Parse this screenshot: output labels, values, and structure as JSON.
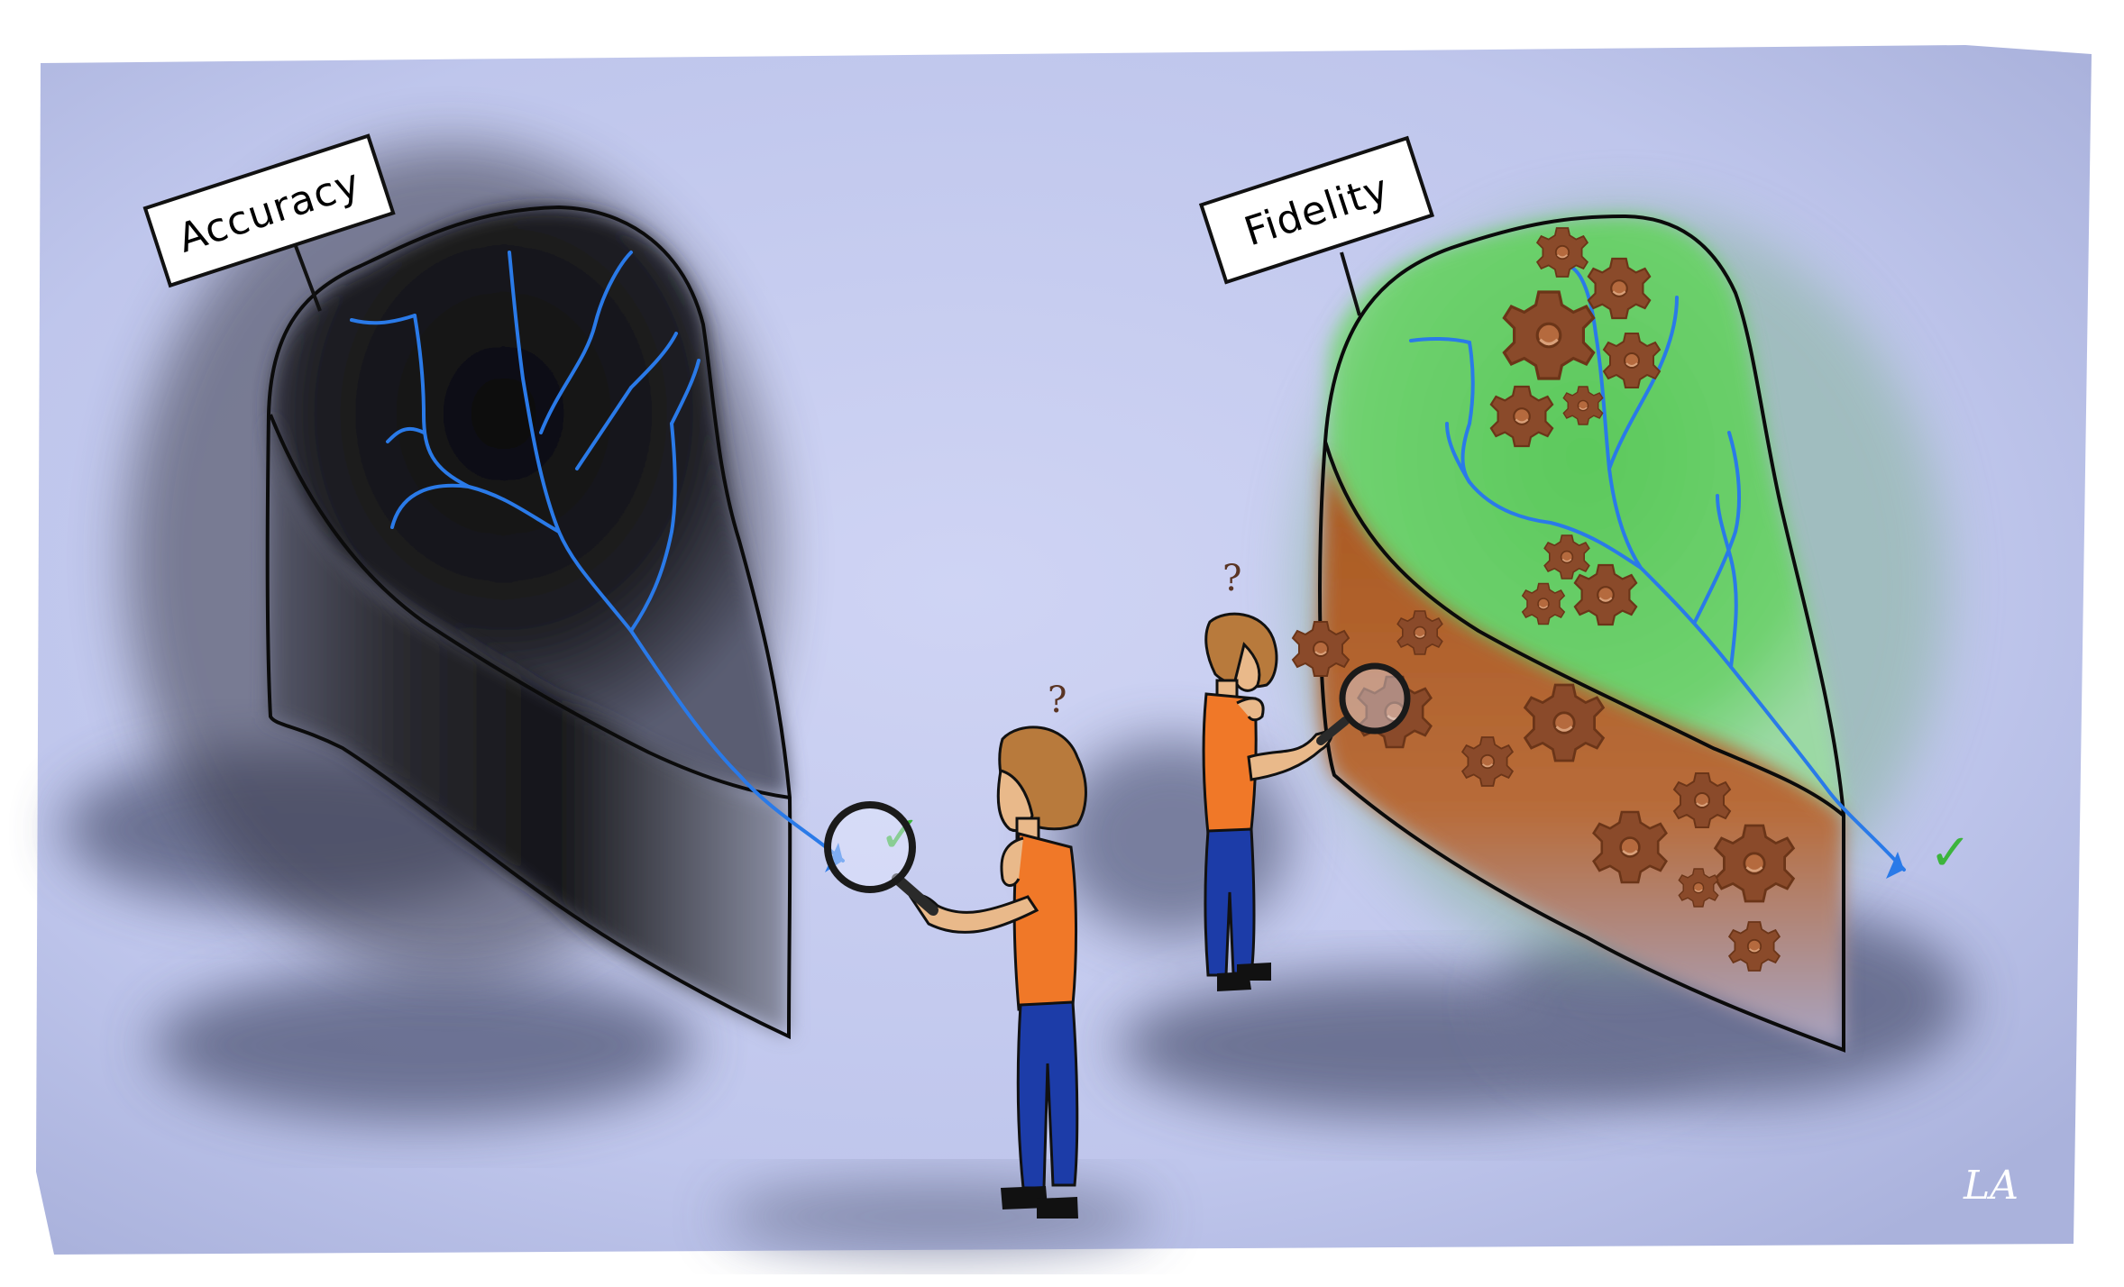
{
  "labels": {
    "left_sign": "Accuracy",
    "right_sign": "Fidelity"
  },
  "annotations": {
    "question_mark": "?",
    "check_mark": "✓",
    "signature": "LA"
  },
  "colors": {
    "background": "#c5cbef",
    "accuracy_hill_top": "#141416",
    "accuracy_hill_side": "#2a2a2e",
    "fidelity_top": "#63cf63",
    "fidelity_side": "#b4622c",
    "gear": "#8a4a2a",
    "river": "#2a7ae8",
    "shirt": "#f07828",
    "jeans": "#1c3ca8",
    "hair": "#b87a3c",
    "skin": "#e9b98a",
    "check": "#3cb43c"
  },
  "icons": [
    "magnifying-glass-icon",
    "gear-icon",
    "question-mark-icon",
    "check-mark-icon"
  ]
}
